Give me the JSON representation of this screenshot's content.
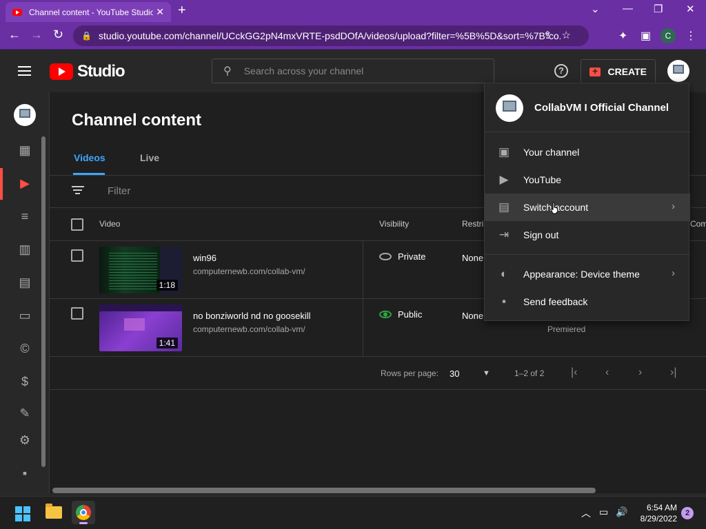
{
  "browser": {
    "tab_title": "Channel content - YouTube Studio",
    "url": "studio.youtube.com/channel/UCckGG2pN4mxVRTE-psdDOfA/videos/upload?filter=%5B%5D&sort=%7B\"co...",
    "profile_initial": "C",
    "theme_color": "#6a2fa3"
  },
  "header": {
    "logo_text": "Studio",
    "search_placeholder": "Search across your channel",
    "create_label": "CREATE"
  },
  "page": {
    "title": "Channel content",
    "tabs": [
      {
        "label": "Videos",
        "active": true
      },
      {
        "label": "Live",
        "active": false
      }
    ],
    "filter_placeholder": "Filter",
    "columns": [
      "Video",
      "Visibility",
      "Restri",
      "Com"
    ],
    "videos": [
      {
        "title": "win96",
        "description": "computernewb.com/collab-vm/",
        "duration": "1:18",
        "visibility": "Private",
        "restrictions": "None"
      },
      {
        "title": "no bonziworld nd no goosekill",
        "description": "computernewb.com/collab-vm/",
        "duration": "1:41",
        "visibility": "Public",
        "restrictions": "None",
        "date_note": "Premiered"
      }
    ],
    "pagination": {
      "rows_label": "Rows per page:",
      "rows_value": "30",
      "range": "1–2 of 2"
    }
  },
  "account_menu": {
    "channel_name": "CollabVM I Official Channel",
    "items": [
      {
        "label": "Your channel",
        "icon": "account-box-icon"
      },
      {
        "label": "YouTube",
        "icon": "youtube-icon"
      },
      {
        "label": "Switch account",
        "icon": "switch-account-icon",
        "chevron": true
      },
      {
        "label": "Sign out",
        "icon": "sign-out-icon"
      },
      {
        "label": "Appearance: Device theme",
        "icon": "appearance-icon",
        "chevron": true
      },
      {
        "label": "Send feedback",
        "icon": "feedback-icon"
      }
    ]
  },
  "taskbar": {
    "time": "6:54 AM",
    "date": "8/29/2022",
    "notification_count": "2"
  },
  "colors": {
    "accent": "#3ea6ff",
    "brand_red": "#ff0000",
    "active_red": "#ff4e45",
    "public_green": "#2ba640"
  }
}
